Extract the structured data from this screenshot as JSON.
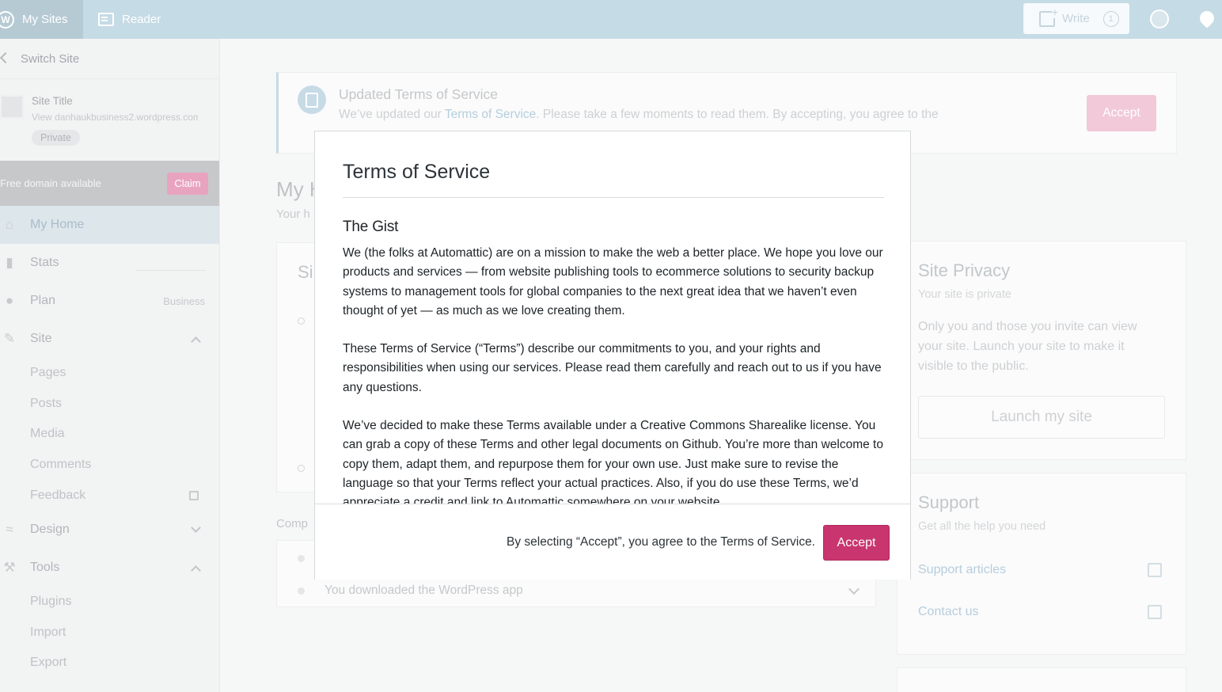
{
  "masterbar": {
    "my_sites": "My Sites",
    "reader": "Reader",
    "write": "Write",
    "write_count": "1"
  },
  "sidebar": {
    "switch_site": "Switch Site",
    "site_title": "Site Title",
    "site_url": "View danhaukbusiness2.wordpress.com",
    "private_badge": "Private",
    "free_domain": "Free domain available",
    "claim": "Claim",
    "items": {
      "my_home": "My Home",
      "stats": "Stats",
      "plan": "Plan",
      "plan_badge": "Business",
      "site": "Site",
      "design": "Design",
      "tools": "Tools"
    },
    "site_sub": [
      "Pages",
      "Posts",
      "Media",
      "Comments",
      "Feedback"
    ],
    "tools_sub": [
      "Plugins",
      "Import",
      "Export"
    ]
  },
  "banner": {
    "title": "Updated Terms of Service",
    "text_before": "We’ve updated our ",
    "link": "Terms of Service",
    "text_after": ". Please take a few moments to read them. By accepting, you agree to the",
    "accept": "Accept"
  },
  "home": {
    "title_partial": "My H",
    "sub_partial": "Your h",
    "setup_title_partial": "Si",
    "completed_partial": "Comp",
    "completed_row": "You downloaded the WordPress app"
  },
  "privacy": {
    "title": "Site Privacy",
    "subtitle": "Your site is private",
    "body": "Only you and those you invite can view your site. Launch your site to make it visible to the public.",
    "launch": "Launch my site"
  },
  "support": {
    "title": "Support",
    "subtitle": "Get all the help you need",
    "link1": "Support articles",
    "link2": "Contact us"
  },
  "modal": {
    "title": "Terms of Service",
    "section": "The Gist",
    "p1": "We (the folks at Automattic) are on a mission to make the web a better place. We hope you love our products and services — from website publishing tools to ecommerce solutions to security backup systems to management tools for global companies to the next great idea that we haven’t even thought of yet — as much as we love creating them.",
    "p2": "These Terms of Service (“Terms”) describe our commitments to you, and your rights and responsibilities when using our services. Please read them carefully and reach out to us if you have any questions.",
    "p3": "We’ve decided to make these Terms available under a Creative Commons Sharealike license. You can grab a copy of these Terms and other legal documents on Github. You’re more than welcome to copy them, adapt them, and repurpose them for your own use. Just make sure to revise the language so that your Terms reflect your actual practices. Also, if you do use these Terms, we’d appreciate a credit and link to Automattic somewhere on your website.",
    "footer_text": "By selecting “Accept”, you agree to the Terms of Service.",
    "accept": "Accept"
  }
}
